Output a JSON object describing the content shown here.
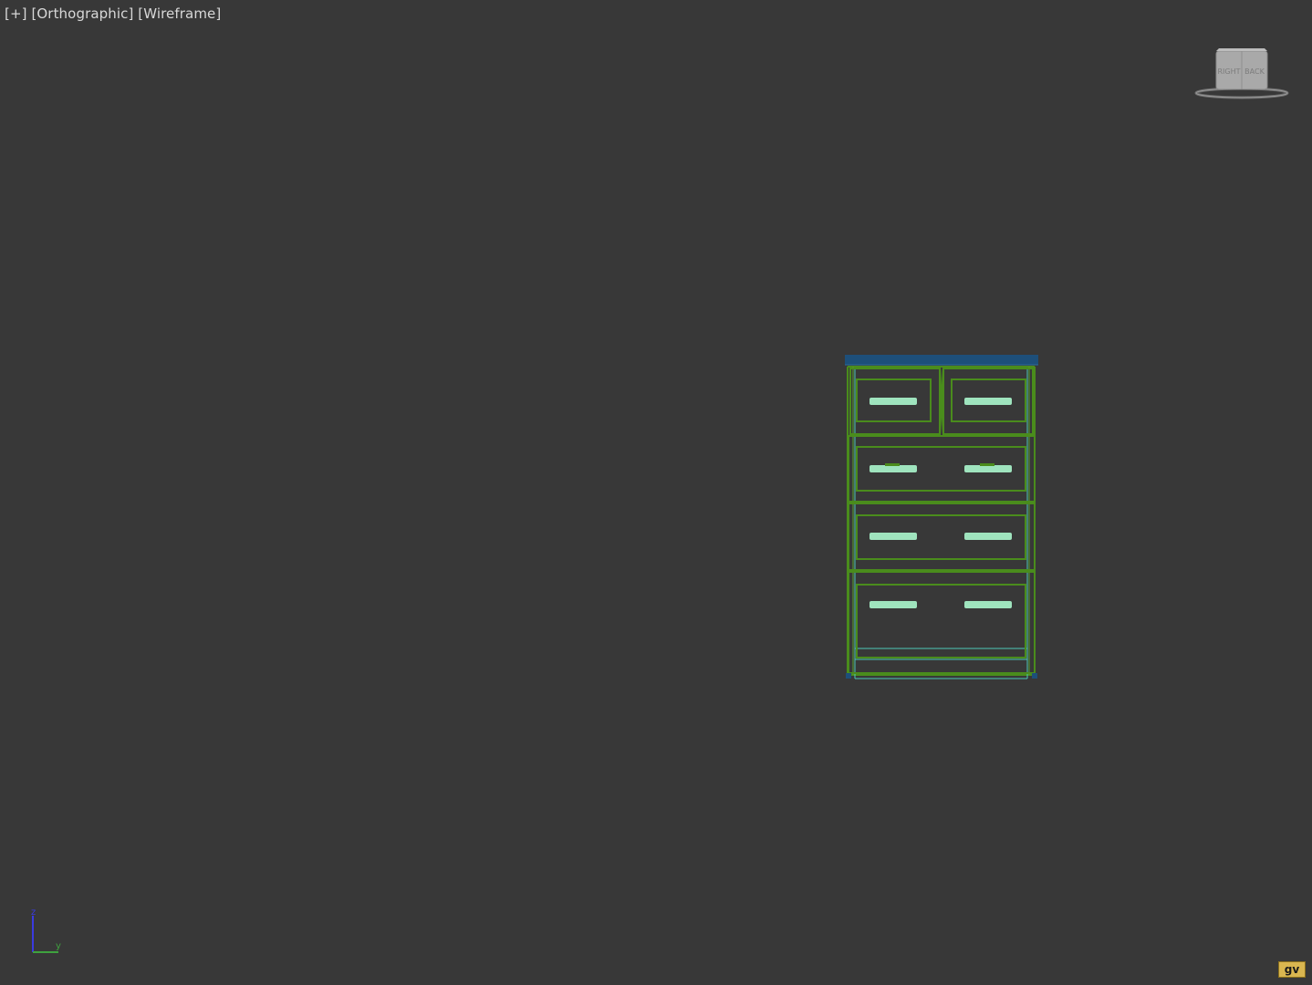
{
  "viewport": {
    "menu_plus": "[+]",
    "view_mode": "[Orthographic]",
    "shading_mode": "[Wireframe]"
  },
  "viewcube": {
    "face_labels": [
      "RIGHT",
      "BACK"
    ]
  },
  "axis_tripod": {
    "z_label": "z",
    "y_label": "y"
  },
  "badge": {
    "label": "gv"
  },
  "colors": {
    "background": "#383838",
    "wire_green": "#4a8c1c",
    "handle_mint": "#9fe4be",
    "top_blue": "#1d4f7a",
    "inner_cyan": "#4ec7b8",
    "axis_blue": "#3a3ae0",
    "axis_green": "#3fa23f",
    "badge_yellow": "#d9b650"
  },
  "icons": {
    "viewcube": "viewcube-icon",
    "axis": "axis-tripod-icon"
  }
}
